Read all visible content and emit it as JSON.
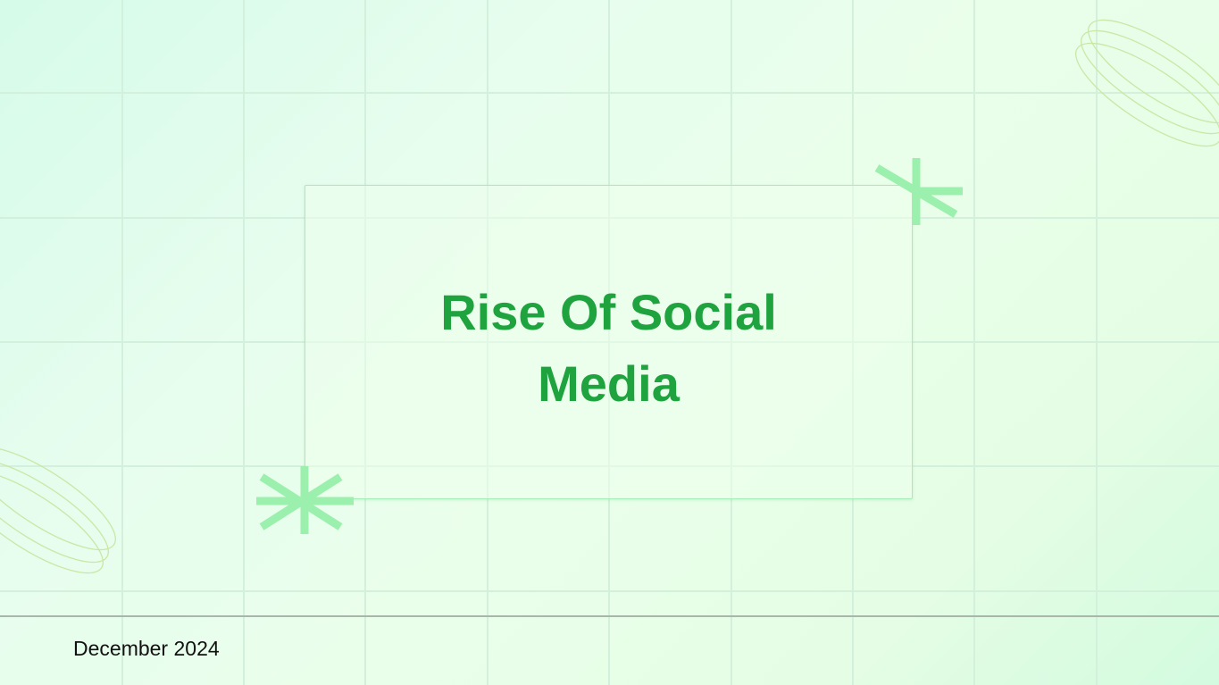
{
  "slide": {
    "title_lines": [
      "Rise Of Social",
      "Media"
    ],
    "footer_date": "December 2024"
  },
  "theme": {
    "title_color": "#1ea33e",
    "accent_green": "#9cf0ad",
    "oval_stroke": "#c9e8a6",
    "grid_line": "#d3f0dc",
    "card_border": "#a6ecb8",
    "divider": "#a8b6ab"
  },
  "decorations": {
    "asterisk_icon": "asterisk-icon",
    "oval_rings": "concentric-oval-rings"
  }
}
